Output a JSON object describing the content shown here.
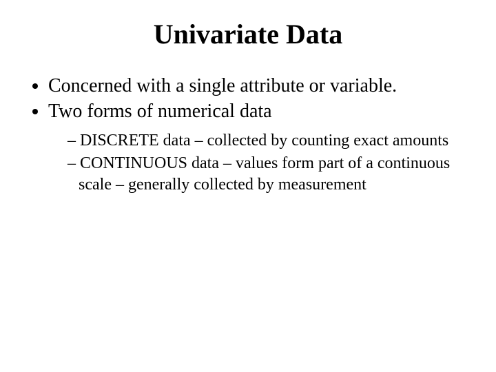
{
  "title": "Univariate Data",
  "bullets": [
    "Concerned with a single attribute or variable.",
    "Two forms of numerical data"
  ],
  "sub_bullets": [
    "DISCRETE data – collected by counting exact amounts",
    "CONTINUOUS data – values form part of a continuous scale – generally collected by measurement"
  ]
}
